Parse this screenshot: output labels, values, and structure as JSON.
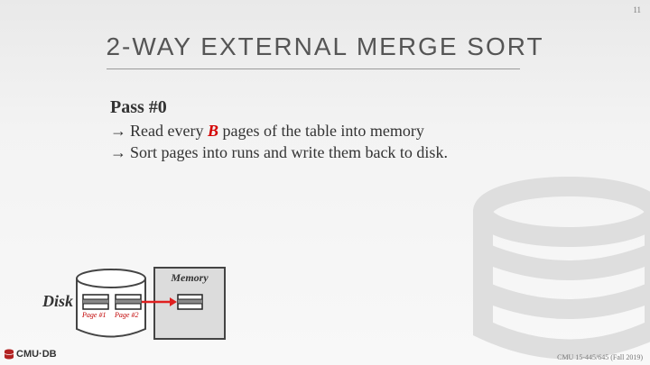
{
  "slide": {
    "page_number": "11",
    "title": "2-WAY EXTERNAL MERGE SORT",
    "pass_title": "Pass #0",
    "bullets": [
      {
        "arrow": "→",
        "before": "Read every ",
        "highlight": "B",
        "after": " pages of the table into memory"
      },
      {
        "arrow": "→",
        "before": "Sort pages into runs and write them back to disk.",
        "highlight": "",
        "after": ""
      }
    ]
  },
  "diagram": {
    "disk_label": "Disk",
    "memory_label": "Memory",
    "page_labels": [
      "Page #1",
      "Page #2"
    ]
  },
  "footer": {
    "logo_text": "CMU·DB",
    "course": "CMU 15-445/645 (Fall 2019)"
  },
  "colors": {
    "accent_red": "#d40000",
    "arrow_red": "#e02020",
    "title_gray": "#555555"
  }
}
